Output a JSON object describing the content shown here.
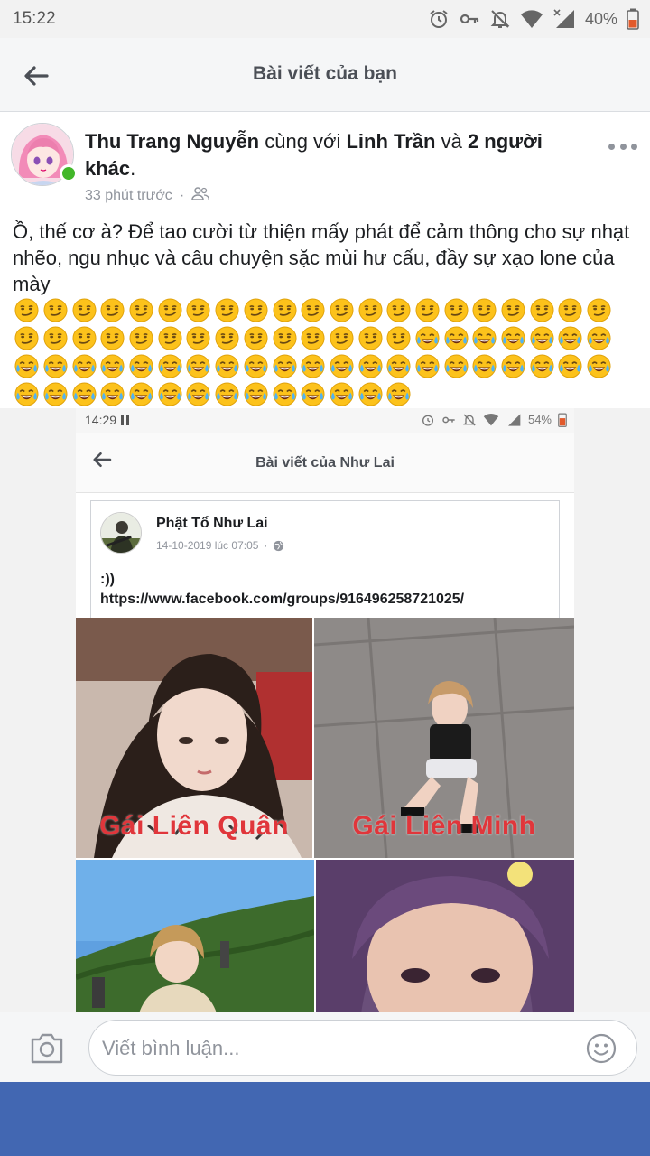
{
  "status_bar": {
    "time": "15:22",
    "battery": "40%",
    "icons": [
      "alarm-icon",
      "key-icon",
      "bell-off-icon",
      "wifi-icon",
      "signal-icon",
      "battery-icon"
    ]
  },
  "header": {
    "title": "Bài viết của bạn",
    "back_icon": "arrow-left-icon"
  },
  "post": {
    "author": "Thu Trang Nguyễn",
    "with_text": " cùng với ",
    "tagged": "Linh Trần",
    "and_text": " và ",
    "others": "2 người khác",
    "period": ".",
    "time": "33 phút trước",
    "dot": "·",
    "audience_icon": "friends-icon",
    "more_icon": "more-horizontal-icon",
    "text": "Ồ, thế cơ à? Để tao cười từ thiện mấy phát để cảm thông cho sự nhạt nhẽo, ngu nhục và câu chuyện sặc mùi hư cấu, đầy sự xạo lone của mày",
    "emoji_rows": [
      [
        "smirk",
        "smirk",
        "smirk",
        "smirk",
        "smirk",
        "smirk",
        "smirk",
        "smirk",
        "smirk",
        "smirk",
        "smirk",
        "smirk",
        "smirk",
        "smirk",
        "smirk",
        "smirk",
        "smirk",
        "smirk",
        "smirk",
        "smirk",
        "smirk"
      ],
      [
        "smirk",
        "smirk",
        "smirk",
        "smirk",
        "smirk",
        "smirk",
        "smirk",
        "smirk",
        "smirk",
        "smirk",
        "smirk",
        "smirk",
        "smirk",
        "smirk",
        "joy",
        "joy",
        "joy",
        "joy",
        "joy",
        "joy",
        "joy"
      ],
      [
        "joy",
        "joy",
        "joy",
        "joy",
        "joy",
        "joy",
        "joy",
        "joy",
        "joy",
        "joy",
        "joy",
        "joy",
        "joy",
        "joy",
        "joy",
        "joy",
        "joy",
        "joy",
        "joy",
        "joy",
        "joy"
      ],
      [
        "joy",
        "joy",
        "joy",
        "joy",
        "joy",
        "joy",
        "joy",
        "joy",
        "joy",
        "joy",
        "joy",
        "joy",
        "joy",
        "joy"
      ]
    ]
  },
  "embedded": {
    "status_time": "14:29",
    "status_battery": "54%",
    "title": "Bài viết của Như Lai",
    "author": "Phật Tổ Như Lai",
    "date": "14-10-2019 lúc 07:05",
    "dot": "·",
    "text_line1": ":))",
    "text_line2": "https://www.facebook.com/groups/916496258721025/",
    "captions": [
      "Gái Liên Quân",
      "Gái Liên Minh"
    ]
  },
  "comment": {
    "placeholder": "Viết bình luận...",
    "camera_icon": "camera-icon",
    "emoji_icon": "smiley-icon"
  },
  "colors": {
    "brand": "#4267b2",
    "online": "#42b72a",
    "caption_red": "#e0363b"
  }
}
